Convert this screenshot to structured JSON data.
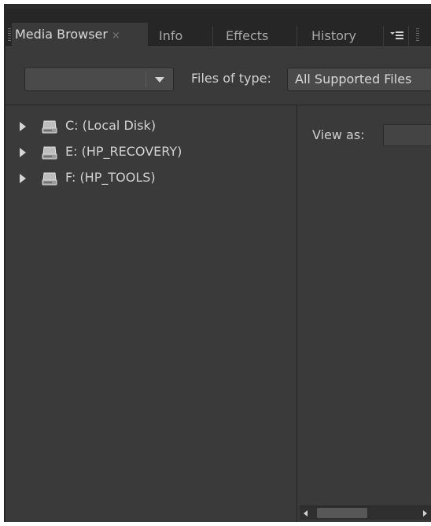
{
  "tabs": [
    {
      "label": "Media Browser",
      "active": true,
      "closable": true,
      "close_glyph": "×"
    },
    {
      "label": "Info",
      "active": false
    },
    {
      "label": "Effects",
      "active": false
    },
    {
      "label": "History",
      "active": false
    }
  ],
  "panel_menu_icon": "panel-menu-icon",
  "toolbar": {
    "location_dropdown_value": "",
    "files_of_type_label": "Files of type:",
    "files_of_type_value": "All Supported Files"
  },
  "tree": [
    {
      "label": "C: (Local Disk)",
      "icon": "drive-icon"
    },
    {
      "label": "E: (HP_RECOVERY)",
      "icon": "drive-icon"
    },
    {
      "label": "F: (HP_TOOLS)",
      "icon": "drive-icon"
    }
  ],
  "right": {
    "view_as_label": "View as:",
    "view_as_value": ""
  },
  "colors": {
    "panel_bg": "#3a3a3a",
    "tabbar_bg": "#262626",
    "text": "#d2d2d2"
  }
}
